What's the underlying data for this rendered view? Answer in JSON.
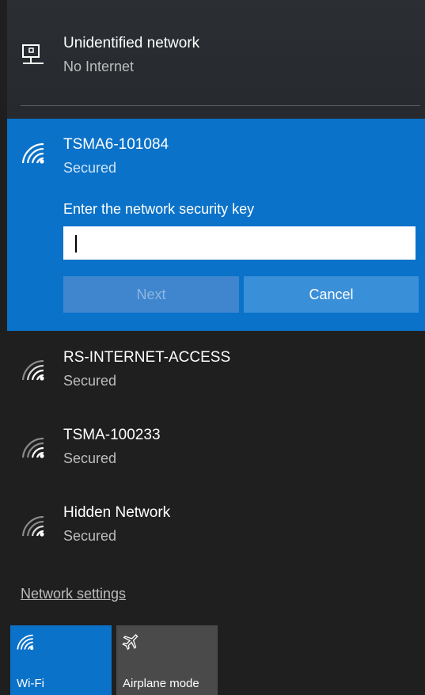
{
  "connected": {
    "name": "Unidentified network",
    "status": "No Internet",
    "icon": "monitor-network-icon"
  },
  "selected_network": {
    "name": "TSMA6-101084",
    "status": "Secured",
    "icon": "wifi-icon",
    "prompt": "Enter the network security key",
    "key_value": "",
    "next_label": "Next",
    "cancel_label": "Cancel"
  },
  "networks": [
    {
      "name": "RS-INTERNET-ACCESS",
      "status": "Secured",
      "icon": "wifi-icon"
    },
    {
      "name": "TSMA-100233",
      "status": "Secured",
      "icon": "wifi-icon"
    },
    {
      "name": "Hidden Network",
      "status": "Secured",
      "icon": "wifi-icon"
    }
  ],
  "settings_link": "Network settings",
  "quick_actions": {
    "wifi_label": "Wi-Fi",
    "airplane_label": "Airplane mode"
  },
  "colors": {
    "accent": "#0a72c9",
    "background": "#1f1f1f",
    "tile_off": "#4a4a4a"
  }
}
